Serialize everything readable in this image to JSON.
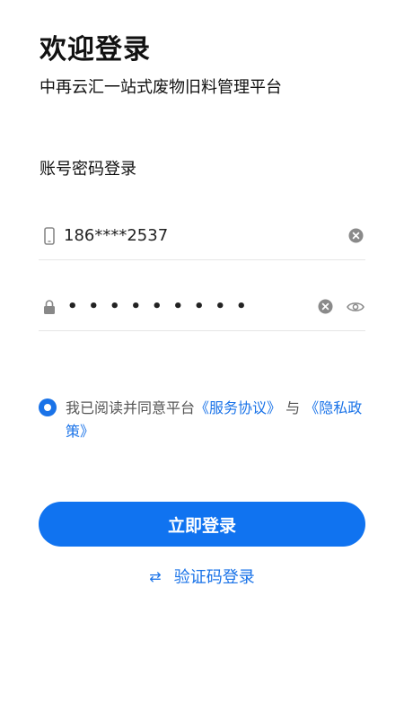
{
  "header": {
    "title": "欢迎登录",
    "subtitle": "中再云汇一站式废物旧料管理平台"
  },
  "login_mode_label": "账号密码登录",
  "phone_field": {
    "value": "186****2537"
  },
  "password_field": {
    "masked_value": "•••••••••"
  },
  "agreement": {
    "checked": true,
    "prefix": "我已阅读并同意平台",
    "service_link": "《服务协议》",
    "connector": "与",
    "privacy_link": "《隐私政策》"
  },
  "login_button_label": "立即登录",
  "switch_login": {
    "icon": "⇄",
    "label": "验证码登录"
  },
  "colors": {
    "accent": "#1073f0",
    "link": "#1a73e8"
  }
}
